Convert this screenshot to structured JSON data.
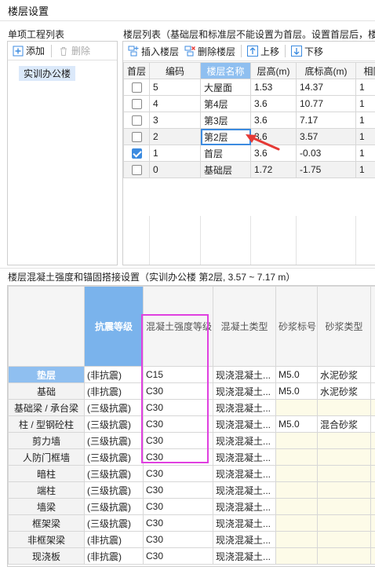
{
  "window_title": "楼层设置",
  "project_pane": {
    "label": "单项工程列表",
    "add_label": "添加",
    "delete_label": "删除",
    "items": [
      "实训办公楼"
    ]
  },
  "floor_pane": {
    "label": "楼层列表（基础层和标准层不能设置为首层。设置首层后，楼",
    "insert_label": "插入楼层",
    "delete_label": "删除楼层",
    "up_label": "上移",
    "down_label": "下移",
    "headers": [
      "首层",
      "编码",
      "楼层名称",
      "层高(m)",
      "底标高(m)",
      "相同"
    ],
    "rows": [
      {
        "first": false,
        "code": "5",
        "name": "大屋面",
        "height": "1.53",
        "bottom": "14.37",
        "same": "1"
      },
      {
        "first": false,
        "code": "4",
        "name": "第4层",
        "height": "3.6",
        "bottom": "10.77",
        "same": "1"
      },
      {
        "first": false,
        "code": "3",
        "name": "第3层",
        "height": "3.6",
        "bottom": "7.17",
        "same": "1"
      },
      {
        "first": false,
        "code": "2",
        "name": "第2层",
        "height": "3.6",
        "bottom": "3.57",
        "same": "1"
      },
      {
        "first": true,
        "code": "1",
        "name": "首层",
        "height": "3.6",
        "bottom": "-0.03",
        "same": "1"
      },
      {
        "first": false,
        "code": "0",
        "name": "基础层",
        "height": "1.72",
        "bottom": "-1.75",
        "same": "1"
      }
    ]
  },
  "concrete_section": {
    "label": "楼层混凝土强度和锚固搭接设置（实训办公楼  第2层, 3.57 ~ 7.17 m）",
    "headers": [
      "抗震等级",
      "混凝土强度等级",
      "混凝土类型",
      "砂浆标号",
      "砂浆类型"
    ],
    "rows": [
      {
        "name": "垫层",
        "seismic": "(非抗震)",
        "grade": "C15",
        "type": "现浇混凝土...",
        "mortar": "M5.0",
        "mortar_type": "水泥砂浆"
      },
      {
        "name": "基础",
        "seismic": "(非抗震)",
        "grade": "C30",
        "type": "现浇混凝土...",
        "mortar": "M5.0",
        "mortar_type": "水泥砂浆"
      },
      {
        "name": "基础梁 / 承台梁",
        "seismic": "(三级抗震)",
        "grade": "C30",
        "type": "现浇混凝土...",
        "mortar": "",
        "mortar_type": ""
      },
      {
        "name": "柱 / 型钢砼柱",
        "seismic": "(三级抗震)",
        "grade": "C30",
        "type": "现浇混凝土...",
        "mortar": "M5.0",
        "mortar_type": "混合砂浆"
      },
      {
        "name": "剪力墙",
        "seismic": "(三级抗震)",
        "grade": "C30",
        "type": "现浇混凝土...",
        "mortar": "",
        "mortar_type": ""
      },
      {
        "name": "人防门框墙",
        "seismic": "(三级抗震)",
        "grade": "C30",
        "type": "现浇混凝土...",
        "mortar": "",
        "mortar_type": ""
      },
      {
        "name": "暗柱",
        "seismic": "(三级抗震)",
        "grade": "C30",
        "type": "现浇混凝土...",
        "mortar": "",
        "mortar_type": ""
      },
      {
        "name": "端柱",
        "seismic": "(三级抗震)",
        "grade": "C30",
        "type": "现浇混凝土...",
        "mortar": "",
        "mortar_type": ""
      },
      {
        "name": "墙梁",
        "seismic": "(三级抗震)",
        "grade": "C30",
        "type": "现浇混凝土...",
        "mortar": "",
        "mortar_type": ""
      },
      {
        "name": "框架梁",
        "seismic": "(三级抗震)",
        "grade": "C30",
        "type": "现浇混凝土...",
        "mortar": "",
        "mortar_type": ""
      },
      {
        "name": "非框架梁",
        "seismic": "(非抗震)",
        "grade": "C30",
        "type": "现浇混凝土...",
        "mortar": "",
        "mortar_type": ""
      },
      {
        "name": "现浇板",
        "seismic": "(非抗震)",
        "grade": "C30",
        "type": "现浇混凝土...",
        "mortar": "",
        "mortar_type": ""
      }
    ]
  },
  "colors": {
    "accent": "#3c8be0",
    "header_selected": "#7ab3ec",
    "highlight_box": "#e040e0",
    "arrow": "#e53935"
  }
}
